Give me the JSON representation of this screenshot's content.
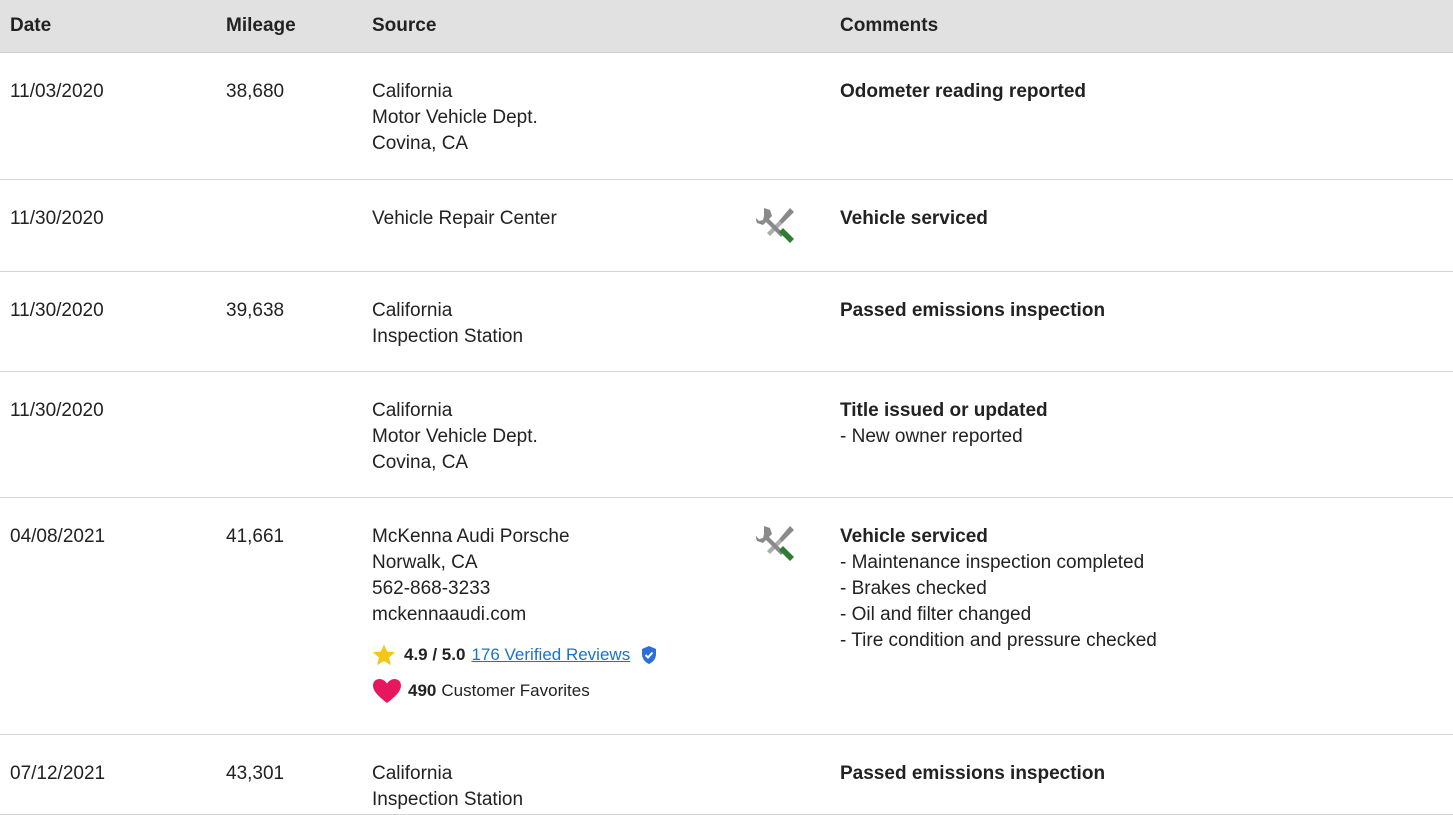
{
  "headers": {
    "date": "Date",
    "mileage": "Mileage",
    "source": "Source",
    "comments": "Comments"
  },
  "rows": [
    {
      "date": "11/03/2020",
      "mileage": "38,680",
      "source": [
        "California",
        "Motor Vehicle Dept.",
        "Covina, CA"
      ],
      "service_icon": false,
      "comment_title": "Odometer reading reported",
      "comment_details": []
    },
    {
      "date": "11/30/2020",
      "mileage": "",
      "source": [
        "Vehicle Repair Center"
      ],
      "service_icon": true,
      "comment_title": "Vehicle serviced",
      "comment_details": []
    },
    {
      "date": "11/30/2020",
      "mileage": "39,638",
      "source": [
        "California",
        "Inspection Station"
      ],
      "service_icon": false,
      "comment_title": "Passed emissions inspection",
      "comment_details": []
    },
    {
      "date": "11/30/2020",
      "mileage": "",
      "source": [
        "California",
        "Motor Vehicle Dept.",
        "Covina, CA"
      ],
      "service_icon": false,
      "comment_title": "Title issued or updated",
      "comment_details": [
        "- New owner reported"
      ]
    },
    {
      "date": "04/08/2021",
      "mileage": "41,661",
      "source": [
        "McKenna Audi Porsche",
        "Norwalk, CA",
        "562-868-3233",
        "mckennaaudi.com"
      ],
      "service_icon": true,
      "rating": {
        "score": "4.9 / 5.0",
        "reviews": "176 Verified Reviews",
        "favorites_count": "490",
        "favorites_label": "Customer Favorites"
      },
      "comment_title": "Vehicle serviced",
      "comment_details": [
        "- Maintenance inspection completed",
        "- Brakes checked",
        "- Oil and filter changed",
        "- Tire condition and pressure checked"
      ]
    },
    {
      "date": "07/12/2021",
      "mileage": "43,301",
      "source": [
        "California",
        "Inspection Station"
      ],
      "service_icon": false,
      "comment_title": "Passed emissions inspection",
      "comment_details": []
    }
  ],
  "colors": {
    "header_bg": "#e1e1e1",
    "link": "#1a73c8",
    "star": "#f5c518",
    "heart": "#e8175d",
    "verified": "#2d6fd6",
    "wrench_green": "#2e7d32",
    "wrench_gray": "#8a8a8a"
  },
  "icons": {
    "service": "wrench-screwdriver-icon",
    "star": "star-icon",
    "verified": "verified-shield-icon",
    "favorite": "heart-icon"
  }
}
